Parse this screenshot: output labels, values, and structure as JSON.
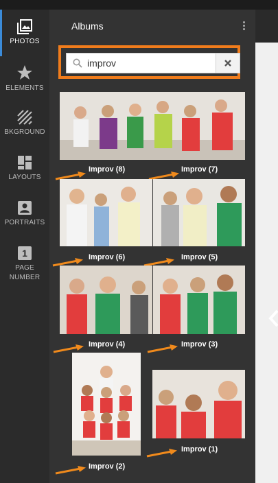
{
  "sidebar": {
    "items": [
      {
        "id": "photos",
        "label": "PHOTOS",
        "icon": "photos-icon",
        "active": true
      },
      {
        "id": "elements",
        "label": "ELEMENTS",
        "icon": "star-icon",
        "active": false
      },
      {
        "id": "background",
        "label": "BKGROUND",
        "icon": "pattern-icon",
        "active": false
      },
      {
        "id": "layouts",
        "label": "LAYOUTS",
        "icon": "layouts-icon",
        "active": false
      },
      {
        "id": "portraits",
        "label": "PORTRAITS",
        "icon": "portrait-icon",
        "active": false
      },
      {
        "id": "page_number",
        "label": "PAGE NUMBER",
        "icon": "page-number-icon",
        "active": false
      }
    ]
  },
  "panel": {
    "title": "Albums",
    "search": {
      "value": "improv",
      "placeholder": ""
    },
    "albums": [
      {
        "label": "Improv (8)"
      },
      {
        "label": "Improv (7)"
      },
      {
        "label": "Improv (6)"
      },
      {
        "label": "Improv (5)"
      },
      {
        "label": "Improv (4)"
      },
      {
        "label": "Improv (3)"
      },
      {
        "label": "Improv (2)"
      },
      {
        "label": "Improv (1)"
      }
    ]
  },
  "icons": {
    "page_number_glyph": "1"
  },
  "colors": {
    "highlight": "#f07c1c",
    "accent": "#3b8bd9"
  }
}
